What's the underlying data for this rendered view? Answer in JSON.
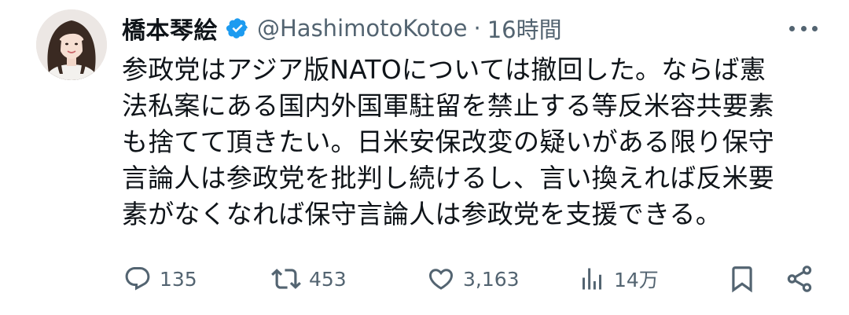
{
  "author": {
    "display_name": "橋本琴絵",
    "handle": "@HashimotoKotoe",
    "separator": "·",
    "time": "16時間"
  },
  "tweet": {
    "lines": [
      "参政党はアジア版NATOについては撤回した。ならば憲",
      "法私案にある国内外国軍駐留を禁止する等反米容共要素",
      "も捨てて頂きたい。日米安保改変の疑いがある限り保守",
      "言論人は参政党を批判し続けるし、言い換えれば反米要",
      "素がなくなれば保守言論人は参政党を支援できる。"
    ]
  },
  "actions": {
    "replies": "135",
    "retweets": "453",
    "likes": "3,163",
    "views": "14万"
  },
  "icons": {
    "verified": "verified-badge-icon",
    "more": "more-icon",
    "reply": "reply-icon",
    "retweet": "retweet-icon",
    "like": "heart-icon",
    "views": "views-icon",
    "bookmark": "bookmark-icon",
    "share": "share-icon"
  },
  "colors": {
    "text": "#0f1419",
    "secondary": "#536471",
    "verified": "#1d9bf0"
  }
}
